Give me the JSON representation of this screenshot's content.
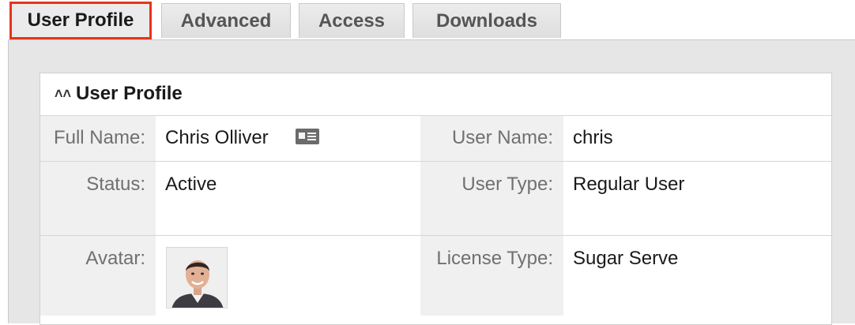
{
  "tabs": [
    {
      "label": "User Profile",
      "active": true
    },
    {
      "label": "Advanced",
      "active": false
    },
    {
      "label": "Access",
      "active": false
    },
    {
      "label": "Downloads",
      "active": false
    }
  ],
  "section": {
    "title": "User Profile",
    "collapse_icon": "double-chevron-up-icon"
  },
  "fields": {
    "full_name": {
      "label": "Full Name:",
      "value": "Chris Olliver",
      "icon": "vcard-icon"
    },
    "user_name": {
      "label": "User Name:",
      "value": "chris"
    },
    "status": {
      "label": "Status:",
      "value": "Active"
    },
    "user_type": {
      "label": "User Type:",
      "value": "Regular User"
    },
    "avatar": {
      "label": "Avatar:",
      "icon": "avatar-photo"
    },
    "license_type": {
      "label": "License Type:",
      "value": "Sugar Serve"
    }
  },
  "colors": {
    "active_tab_border": "#e8341c",
    "panel_bg": "#e6e6e6",
    "label_bg": "#f0f0f0"
  }
}
